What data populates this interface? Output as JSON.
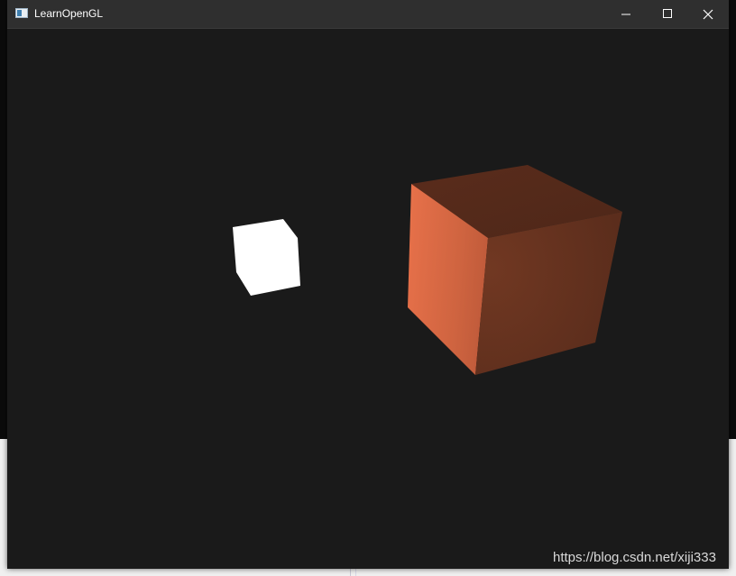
{
  "window": {
    "title": "LearnOpenGL",
    "controls": {
      "minimize_icon": "minimize-icon",
      "maximize_icon": "maximize-icon",
      "close_icon": "close-icon"
    }
  },
  "scene": {
    "background_color": "#1a1a1a",
    "light_cube_color": "#ffffff",
    "object_cube_color": "#e8714a"
  },
  "watermark": "https://blog.csdn.net/xiji333"
}
